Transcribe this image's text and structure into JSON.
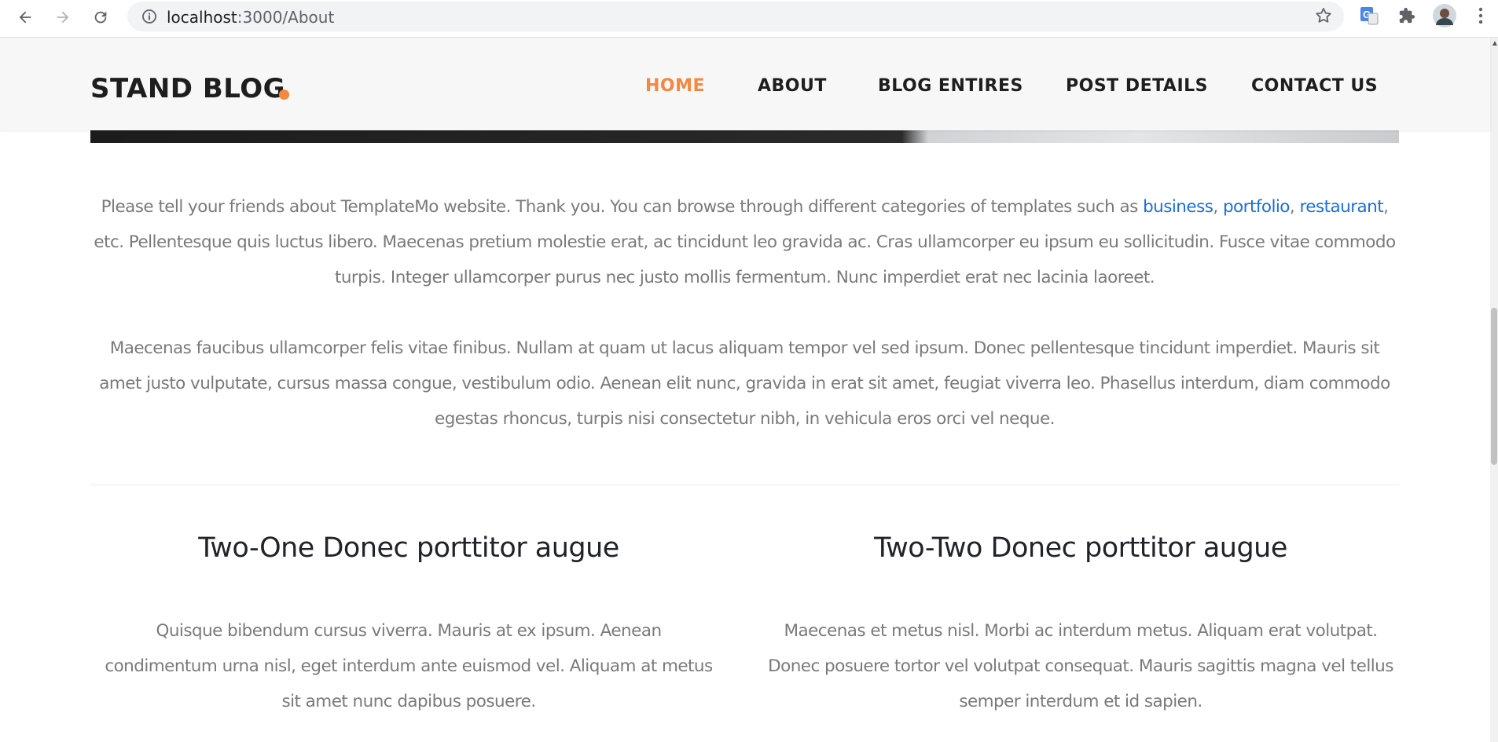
{
  "browser": {
    "url_host": "localhost",
    "url_path": ":3000/About",
    "icons": [
      "back-arrow-icon",
      "forward-arrow-icon",
      "reload-icon",
      "site-info-icon",
      "bookmark-star-icon",
      "translate-extension-icon",
      "extensions-puzzle-icon",
      "profile-avatar",
      "browser-menu-icon"
    ]
  },
  "header": {
    "logo": "STAND BLOG",
    "nav": [
      "HOME",
      "ABOUT",
      "BLOG ENTIRES",
      "POST DETAILS",
      "CONTACT US"
    ],
    "active": "HOME",
    "accent_color": "#f48840"
  },
  "intro": {
    "p1_before": "Please tell your friends about TemplateMo website. Thank you. You can browse through different categories of templates such as",
    "links": [
      "business",
      "portfolio",
      "restaurant"
    ],
    "p1_after": ", etc. Pellentesque quis luctus libero. Maecenas pretium molestie erat, ac tincidunt leo gravida ac. Cras ullamcorper eu ipsum eu sollicitudin. Fusce vitae commodo turpis. Integer ullamcorper purus nec justo mollis fermentum. Nunc imperdiet erat nec lacinia laoreet.",
    "p2": "Maecenas faucibus ullamcorper felis vitae finibus. Nullam at quam ut lacus aliquam tempor vel sed ipsum. Donec pellentesque tincidunt imperdiet. Mauris sit amet justo vulputate, cursus massa congue, vestibulum odio. Aenean elit nunc, gravida in erat sit amet, feugiat viverra leo. Phasellus interdum, diam commodo egestas rhoncus, turpis nisi consectetur nibh, in vehicula eros orci vel neque."
  },
  "columns": [
    {
      "title": "Two-One Donec porttitor augue",
      "text": "Quisque bibendum cursus viverra. Mauris at ex ipsum. Aenean condimentum urna nisl, eget interdum ante euismod vel. Aliquam at metus sit amet nunc dapibus posuere."
    },
    {
      "title": "Two-Two Donec porttitor augue",
      "text": "Maecenas et metus nisl. Morbi ac interdum metus. Aliquam erat volutpat. Donec posuere tortor vel volutpat consequat. Mauris sagittis magna vel tellus semper interdum et id sapien."
    }
  ]
}
